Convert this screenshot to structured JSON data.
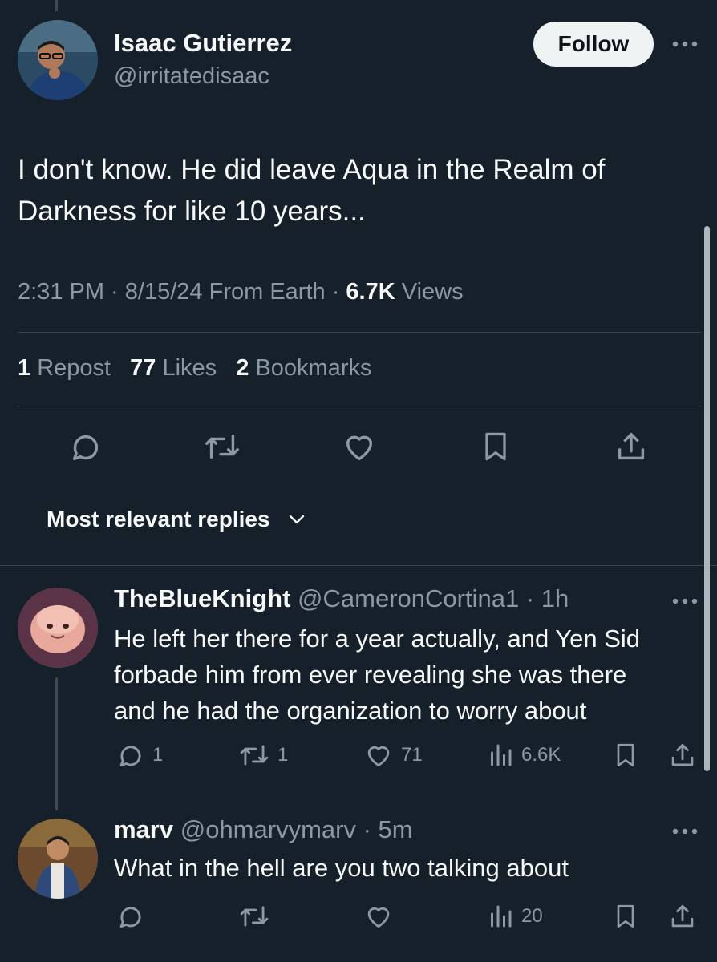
{
  "main_tweet": {
    "author_name": "Isaac Gutierrez",
    "author_handle": "@irritatedisaac",
    "follow_label": "Follow",
    "text": "I don't know. He did leave Aqua in the Realm of Darkness for like 10 years...",
    "time": "2:31 PM",
    "date": "8/15/24",
    "location": "From Earth",
    "views_count": "6.7K",
    "views_label": "Views",
    "reposts_count": "1",
    "reposts_label": "Repost",
    "likes_count": "77",
    "likes_label": "Likes",
    "bookmarks_count": "2",
    "bookmarks_label": "Bookmarks"
  },
  "replies_sort": {
    "label": "Most relevant replies"
  },
  "replies": [
    {
      "author_name": "TheBlueKnight",
      "author_handle": "@CameronCortina1",
      "time": "1h",
      "text_lines": [
        "He left her there for a year actually, and Yen Sid",
        "forbade him from ever revealing she was there",
        "and he had the organization to worry about"
      ],
      "replies_count": "1",
      "reposts_count": "1",
      "likes_count": "71",
      "views_count": "6.6K"
    },
    {
      "author_name": "marv",
      "author_handle": "@ohmarvymarv",
      "time": "5m",
      "text_lines": [
        "What in the hell are you two talking about"
      ],
      "replies_count": "",
      "reposts_count": "",
      "likes_count": "",
      "views_count": "20"
    }
  ],
  "colors": {
    "background": "#15202b",
    "text": "#f7f9f9",
    "muted": "#8b98a5",
    "divider": "#38444d",
    "follow_bg": "#eff3f4"
  },
  "icons": [
    "comment-icon",
    "repost-icon",
    "like-icon",
    "bookmark-icon",
    "share-icon",
    "views-icon",
    "more-icon",
    "chevron-down-icon"
  ]
}
